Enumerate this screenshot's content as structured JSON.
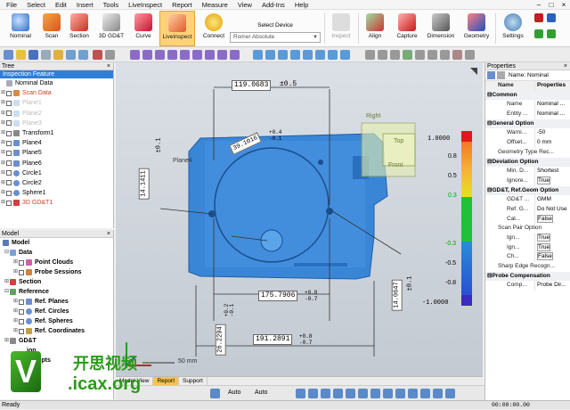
{
  "menu": {
    "items": [
      "File",
      "Select",
      "Edit",
      "Insert",
      "Tools",
      "LiveInspect",
      "Report",
      "Measure",
      "View",
      "Add-Ins",
      "Help"
    ]
  },
  "window_controls": [
    "–",
    "□",
    "×"
  ],
  "ribbon": {
    "buttons": [
      "Nominal",
      "Scan",
      "Section",
      "3D GD&T",
      "Curve",
      "LiveInspect",
      "Connect",
      "Inspect",
      "Align",
      "Capture",
      "Dimension",
      "Geometry",
      "Settings"
    ],
    "select_device_label": "Select Device",
    "device_value": "Romer Absolute"
  },
  "tree": {
    "title": "Tree",
    "header": "Inspection Feature",
    "items": [
      "Nominal Data",
      "Scan Data",
      "Plane1",
      "Plane2",
      "Plane3",
      "Transform1",
      "Plane4",
      "Plane5",
      "Plane6",
      "Circle1",
      "Circle2",
      "Sphere1",
      "3D GD&T1"
    ]
  },
  "model": {
    "title": "Model",
    "root": "Model",
    "items": [
      "Data",
      "Point Clouds",
      "Probe Sessions",
      "Section",
      "Reference",
      "Ref. Planes",
      "Ref. Circles",
      "Ref. Spheres",
      "Ref. Coordinates",
      "GD&T",
      "ion",
      "mmepts"
    ]
  },
  "viewport": {
    "dims": {
      "top": "119.0683",
      "top_tol": "±0.5",
      "diag": "39.1016",
      "diag_tol_p": "+0.4",
      "diag_tol_m": "-0.1",
      "left": "14.1411",
      "left_tol": "±0.1",
      "mid": "175.7906",
      "mid_tol_p": "+0.8",
      "mid_tol_m": "-0.7",
      "bottom": "191.2891",
      "bottom_tol_p": "+0.8",
      "bottom_tol_m": "-0.7",
      "lower_left": "26.2294",
      "lower_left_tol_p": "+0.2",
      "lower_left_tol_m": "-0.1",
      "right": "14.0647",
      "right_tol": "±0.1"
    },
    "plane_label": "Plane4",
    "viewcube": {
      "right": "Right",
      "top": "Top",
      "front": "Front"
    },
    "scale_label": "50 mm"
  },
  "legend": {
    "values": [
      "1.0000",
      "0.8",
      "0.5",
      "0.3",
      "-0.3",
      "-0.5",
      "-0.8",
      "-1.0000"
    ],
    "colors": [
      "#e0191e",
      "#f07a22",
      "#f6b13a",
      "#e6e21e",
      "#1fc03a",
      "#2a8dd8",
      "#2a4fd0",
      "#3a2cc0"
    ]
  },
  "view_tabs": [
    "Model View",
    "Report",
    "Support"
  ],
  "bottom": {
    "auto1": "Auto",
    "auto2": "Auto"
  },
  "status": {
    "text": "Ready",
    "time": "00:00:00.00"
  },
  "properties": {
    "title": "Properties",
    "name_label": "Name: Nominal",
    "col_name": "Name",
    "col_props": "Properties",
    "rows": [
      {
        "type": "cat",
        "n": "Common"
      },
      {
        "n": "Name",
        "v": "Nominal ..."
      },
      {
        "n": "Entity ...",
        "v": "Nominal ..."
      },
      {
        "type": "cat",
        "n": "General Option"
      },
      {
        "n": "Warni...",
        "v": "-50"
      },
      {
        "n": "Offset...",
        "v": "0 mm"
      },
      {
        "type": "sub",
        "n": "Geometry Type Rec..."
      },
      {
        "type": "cat",
        "n": "Deviation Option"
      },
      {
        "n": "Min. D...",
        "v": "Shortest"
      },
      {
        "n": "Ignore...",
        "v": "True",
        "btn": true
      },
      {
        "type": "cat",
        "n": "GD&T, Ref.Geom Option"
      },
      {
        "n": "GD&T ...",
        "v": "GMM"
      },
      {
        "n": "Ref. G...",
        "v": "Do Not Use"
      },
      {
        "n": "Cal...",
        "v": "False",
        "btn": true
      },
      {
        "type": "sub",
        "n": "Scan Pair Option"
      },
      {
        "n": "Ign...",
        "v": "True",
        "btn": true
      },
      {
        "n": "Ign...",
        "v": "True",
        "btn": true
      },
      {
        "n": "Ch...",
        "v": "False",
        "btn": true
      },
      {
        "type": "sub",
        "n": "Sharp Edge Recogn..."
      },
      {
        "type": "cat",
        "n": "Probe Compensation"
      },
      {
        "n": "Comp...",
        "v": "Probe Dir..."
      }
    ]
  },
  "watermark": {
    "text_cn": "开思视频",
    "url": ".icax.org"
  }
}
